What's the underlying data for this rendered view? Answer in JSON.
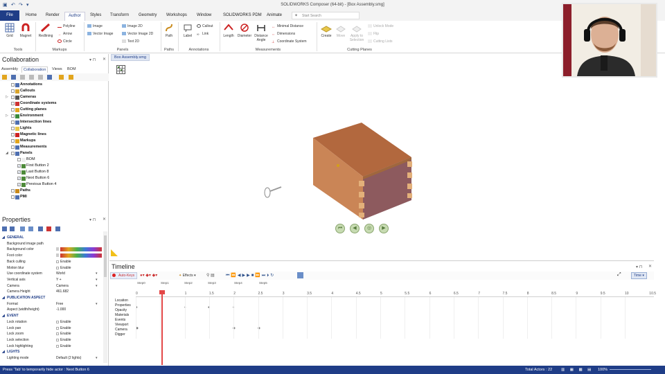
{
  "window": {
    "title": "SOLIDWORKS Composer (64-bit) - [Box Assembly.smg]"
  },
  "tabs": [
    "File",
    "Home",
    "Render",
    "Author",
    "Styles",
    "Transform",
    "Geometry",
    "Workshops",
    "Window",
    "SOLIDWORKS PDM",
    "Animate"
  ],
  "active_tab": "Author",
  "search": {
    "placeholder": "Start Search"
  },
  "ribbon": {
    "tools": {
      "label": "Tools",
      "grid": "Grid",
      "magnet": "Magnet"
    },
    "markups": {
      "label": "Markups",
      "redlining": "Redlining",
      "polyline": "Polyline",
      "arrow": "Arrow",
      "circle": "Circle"
    },
    "panels": {
      "label": "Panels",
      "image": "Image",
      "vector_image": "Vector Image",
      "image_2d": "Image 2D",
      "vector_image_2d": "Vector Image 2D",
      "text_2d": "Text 2D"
    },
    "paths": {
      "label": "Paths",
      "path": "Path"
    },
    "annotations": {
      "label": "Annotations",
      "label_btn": "Label",
      "callout": "Callout",
      "link": "Link"
    },
    "measurements": {
      "label": "Measurements",
      "length": "Length",
      "diameter": "Diameter",
      "distance_angle": "Distance Angle",
      "minimal_distance": "Minimal Distance",
      "dimensions": "Dimensions",
      "coordinate_system": "Coordinate System"
    },
    "cutting_planes": {
      "label": "Cutting Planes",
      "create": "Create",
      "move": "Move",
      "apply_to_selection": "Apply to Selection",
      "unlock_mode": "Unlock Mode",
      "flip": "Flip",
      "cutting_lists": "Cutting Lists"
    }
  },
  "collaboration": {
    "title": "Collaboration",
    "subtabs": [
      "Assembly",
      "Collaboration",
      "Views",
      "BOM"
    ],
    "tree": [
      {
        "label": "Annotations",
        "bold": true,
        "level": 1
      },
      {
        "label": "Callouts",
        "bold": true,
        "level": 1
      },
      {
        "label": "Cameras",
        "bold": true,
        "level": 1
      },
      {
        "label": "Coordinate systems",
        "bold": true,
        "level": 1
      },
      {
        "label": "Cutting planes",
        "bold": true,
        "level": 1
      },
      {
        "label": "Environment",
        "bold": true,
        "level": 1
      },
      {
        "label": "Intersection lines",
        "bold": true,
        "level": 1
      },
      {
        "label": "Lights",
        "bold": true,
        "level": 1
      },
      {
        "label": "Magnetic lines",
        "bold": true,
        "level": 1
      },
      {
        "label": "Markups",
        "bold": true,
        "level": 1
      },
      {
        "label": "Measurements",
        "bold": true,
        "level": 1
      },
      {
        "label": "Panels",
        "bold": true,
        "level": 1
      },
      {
        "label": "BOM",
        "bold": false,
        "level": 2
      },
      {
        "label": "First Button 2",
        "bold": false,
        "level": 2
      },
      {
        "label": "Last Button 8",
        "bold": false,
        "level": 2
      },
      {
        "label": "Next Button 6",
        "bold": false,
        "level": 2
      },
      {
        "label": "Previous Button 4",
        "bold": false,
        "level": 2
      },
      {
        "label": "Paths",
        "bold": true,
        "level": 1
      },
      {
        "label": "PMI",
        "bold": true,
        "level": 1
      }
    ]
  },
  "properties": {
    "title": "Properties",
    "rows": [
      {
        "type": "section",
        "key": "GENERAL"
      },
      {
        "type": "text",
        "key": "Background image path",
        "value": ""
      },
      {
        "type": "gradient",
        "key": "Background color"
      },
      {
        "type": "gradient",
        "key": "Foot color"
      },
      {
        "type": "check",
        "key": "Back culling",
        "value": "Enable"
      },
      {
        "type": "check",
        "key": "Motion blur",
        "value": "Enable"
      },
      {
        "type": "select",
        "key": "Use coordinate system",
        "value": "World"
      },
      {
        "type": "select",
        "key": "Vertical axis",
        "value": "Y +"
      },
      {
        "type": "select",
        "key": "Camera",
        "value": "Camera"
      },
      {
        "type": "text",
        "key": "Camera Height",
        "value": "461.682"
      },
      {
        "type": "section",
        "key": "PUBLICATION ASPECT"
      },
      {
        "type": "select",
        "key": "Format",
        "value": "Free"
      },
      {
        "type": "text",
        "key": "Aspect (width/height)",
        "value": "-1.000"
      },
      {
        "type": "section",
        "key": "EVENT"
      },
      {
        "type": "check",
        "key": "Lock rotation",
        "value": "Enable"
      },
      {
        "type": "check",
        "key": "Lock pan",
        "value": "Enable"
      },
      {
        "type": "check",
        "key": "Lock zoom",
        "value": "Enable"
      },
      {
        "type": "check",
        "key": "Lock selection",
        "value": "Enable"
      },
      {
        "type": "check",
        "key": "Lock highlighting",
        "value": "Enable"
      },
      {
        "type": "section",
        "key": "LIGHTS"
      },
      {
        "type": "select",
        "key": "Lighting mode",
        "value": "Default (2 lights)"
      }
    ]
  },
  "document": {
    "tab": "Box Assembly.smg"
  },
  "timeline": {
    "title": "Timeline",
    "auto_keys": "Auto-Keys",
    "effects": "Effects",
    "time_mode": "Time",
    "steps": [
      "Step0",
      "Step1",
      "Step2",
      "Step3",
      "Step4",
      "Step5"
    ],
    "ticks": [
      "0",
      "0.5",
      "1",
      "1.5",
      "2",
      "2.5",
      "3",
      "3.5",
      "4",
      "4.5",
      "5",
      "5.5",
      "6",
      "6.5",
      "7",
      "7.5",
      "8",
      "8.5",
      "9",
      "9.5",
      "10",
      "10.5"
    ],
    "rows": [
      "Location",
      "Properties",
      "Opacity",
      "Materials",
      "Events",
      "Viewport",
      "Camera",
      "Digger"
    ]
  },
  "status": {
    "hint": "Press 'Tab' to temporarily hide actor : Next Button 6",
    "total_actors": "Total Actors : 22",
    "zoom": "100%"
  },
  "colors": {
    "accent": "#1f3d87",
    "playhead": "#e34848",
    "wood": "#b26a3f"
  }
}
